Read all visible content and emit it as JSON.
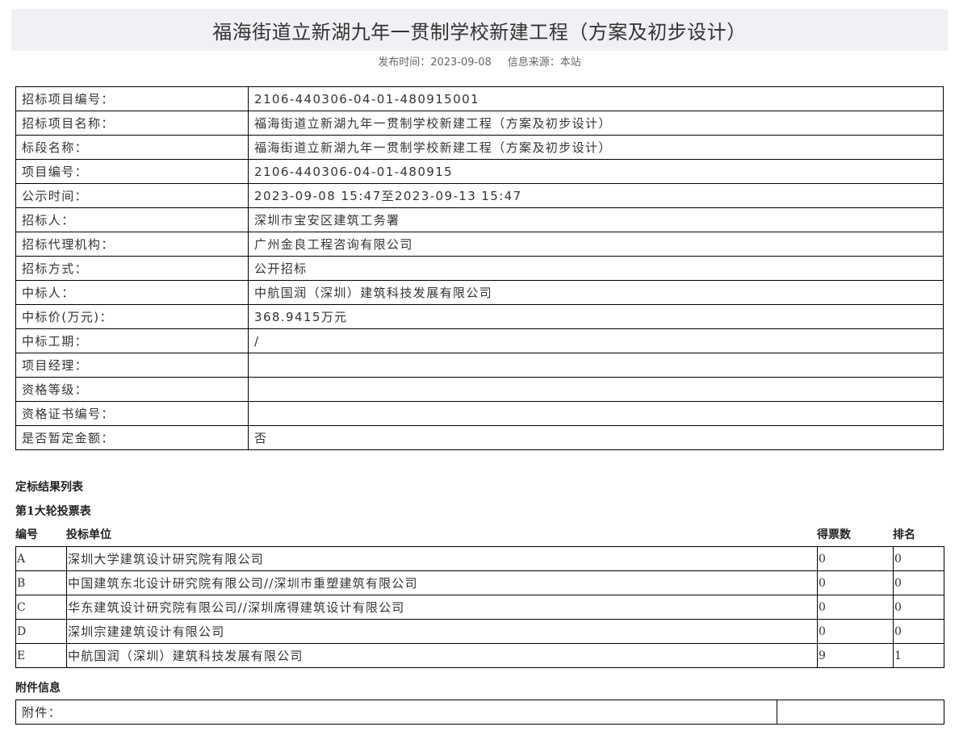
{
  "header": {
    "title": "福海街道立新湖九年一贯制学校新建工程（方案及初步设计）",
    "publish_label": "发布时间：",
    "publish_date": "2023-09-08",
    "source_label": "信息来源：",
    "source_value": "本站"
  },
  "info_rows": [
    {
      "label": "招标项目编号：",
      "value": "2106-440306-04-01-480915001"
    },
    {
      "label": "招标项目名称：",
      "value": "福海街道立新湖九年一贯制学校新建工程（方案及初步设计）"
    },
    {
      "label": "标段名称：",
      "value": "福海街道立新湖九年一贯制学校新建工程（方案及初步设计）"
    },
    {
      "label": "项目编号：",
      "value": "2106-440306-04-01-480915"
    },
    {
      "label": "公示时间：",
      "value": "2023-09-08 15:47至2023-09-13 15:47"
    },
    {
      "label": "招标人：",
      "value": "深圳市宝安区建筑工务署"
    },
    {
      "label": "招标代理机构：",
      "value": "广州金良工程咨询有限公司"
    },
    {
      "label": "招标方式：",
      "value": "公开招标"
    },
    {
      "label": "中标人：",
      "value": "中航国润（深圳）建筑科技发展有限公司"
    },
    {
      "label": "中标价(万元)：",
      "value": "368.9415万元"
    },
    {
      "label": "中标工期：",
      "value": "/"
    },
    {
      "label": "项目经理：",
      "value": ""
    },
    {
      "label": "资格等级：",
      "value": ""
    },
    {
      "label": "资格证书编号：",
      "value": ""
    },
    {
      "label": "是否暂定金额：",
      "value": "否"
    }
  ],
  "result_section": {
    "title": "定标结果列表",
    "round_title": "第1大轮投票表",
    "columns": {
      "id": "编号",
      "bidder": "投标单位",
      "votes": "得票数",
      "rank": "排名"
    },
    "rows": [
      {
        "id": "A",
        "bidder": "深圳大学建筑设计研究院有限公司",
        "votes": "0",
        "rank": "0"
      },
      {
        "id": "B",
        "bidder": "中国建筑东北设计研究院有限公司//深圳市重塑建筑有限公司",
        "votes": "0",
        "rank": "0"
      },
      {
        "id": "C",
        "bidder": "华东建筑设计研究院有限公司//深圳席得建筑设计有限公司",
        "votes": "0",
        "rank": "0"
      },
      {
        "id": "D",
        "bidder": "深圳宗建建筑设计有限公司",
        "votes": "0",
        "rank": "0"
      },
      {
        "id": "E",
        "bidder": "中航国润（深圳）建筑科技发展有限公司",
        "votes": "9",
        "rank": "1"
      }
    ]
  },
  "attachment": {
    "title": "附件信息",
    "label": "附件：",
    "value": ""
  }
}
